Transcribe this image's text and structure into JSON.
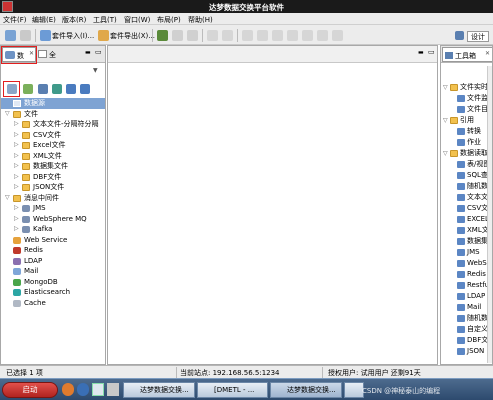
{
  "window": {
    "title": "达梦数据交换平台软件"
  },
  "menu": [
    "文件(F)",
    "编辑(E)",
    "版本(R)",
    "工具(T)",
    "窗口(W)",
    "布局(P)",
    "帮助(H)"
  ],
  "toolbar": {
    "import_label": "套件导入(I)...",
    "export_label": "套件导出(X)...",
    "design_label": "设计"
  },
  "left_panel": {
    "tab_label": "数",
    "tab_label2": "全",
    "root_label": "数据源",
    "tree": [
      {
        "label": "文件",
        "level": 0,
        "expanded": true,
        "icon": "folder"
      },
      {
        "label": "文本文件-分隔符分隔",
        "level": 1,
        "expanded": false,
        "icon": "folder"
      },
      {
        "label": "CSV文件",
        "level": 1,
        "expanded": false,
        "icon": "folder"
      },
      {
        "label": "Excel文件",
        "level": 1,
        "expanded": false,
        "icon": "folder"
      },
      {
        "label": "XML文件",
        "level": 1,
        "expanded": false,
        "icon": "folder"
      },
      {
        "label": "数据集文件",
        "level": 1,
        "expanded": false,
        "icon": "folder"
      },
      {
        "label": "DBF文件",
        "level": 1,
        "expanded": false,
        "icon": "folder"
      },
      {
        "label": "JSON文件",
        "level": 1,
        "expanded": false,
        "icon": "folder"
      },
      {
        "label": "消息中间件",
        "level": 0,
        "expanded": true,
        "icon": "folder"
      },
      {
        "label": "JMS",
        "level": 1,
        "expanded": false,
        "icon": "mq"
      },
      {
        "label": "WebSphere MQ",
        "level": 1,
        "expanded": false,
        "icon": "mq"
      },
      {
        "label": "Kafka",
        "level": 1,
        "expanded": false,
        "icon": "mq"
      },
      {
        "label": "Web Service",
        "level": 0,
        "expanded": null,
        "icon": "web"
      },
      {
        "label": "Redis",
        "level": 0,
        "expanded": null,
        "icon": "redis"
      },
      {
        "label": "LDAP",
        "level": 0,
        "expanded": null,
        "icon": "ldap"
      },
      {
        "label": "Mail",
        "level": 0,
        "expanded": null,
        "icon": "mail"
      },
      {
        "label": "MongoDB",
        "level": 0,
        "expanded": null,
        "icon": "mongo"
      },
      {
        "label": "Elasticsearch",
        "level": 0,
        "expanded": null,
        "icon": "es"
      },
      {
        "label": "Cache",
        "level": 0,
        "expanded": null,
        "icon": "cache"
      }
    ]
  },
  "right_panel": {
    "tab_label": "工具箱",
    "items": [
      {
        "label": "文件实时",
        "level": 0,
        "icon": "folder"
      },
      {
        "label": "文件监",
        "level": 1,
        "icon": "tool"
      },
      {
        "label": "文件目",
        "level": 1,
        "icon": "tool"
      },
      {
        "label": "引用",
        "level": 0,
        "icon": "folder"
      },
      {
        "label": "转换",
        "level": 1,
        "icon": "tool"
      },
      {
        "label": "作业",
        "level": 1,
        "icon": "tool"
      },
      {
        "label": "数据读取",
        "level": 0,
        "icon": "folder"
      },
      {
        "label": "表/视图",
        "level": 1,
        "icon": "tool"
      },
      {
        "label": "SQL查",
        "level": 1,
        "icon": "tool"
      },
      {
        "label": "随机数",
        "level": 1,
        "icon": "tool"
      },
      {
        "label": "文本文",
        "level": 1,
        "icon": "tool"
      },
      {
        "label": "CSV文",
        "level": 1,
        "icon": "tool"
      },
      {
        "label": "EXCEL",
        "level": 1,
        "icon": "tool"
      },
      {
        "label": "XML文",
        "level": 1,
        "icon": "tool"
      },
      {
        "label": "数据集",
        "level": 1,
        "icon": "tool"
      },
      {
        "label": "JMS",
        "level": 1,
        "icon": "tool"
      },
      {
        "label": "WebS",
        "level": 1,
        "icon": "tool"
      },
      {
        "label": "Redis",
        "level": 1,
        "icon": "tool"
      },
      {
        "label": "Restfu",
        "level": 1,
        "icon": "tool"
      },
      {
        "label": "LDAP",
        "level": 1,
        "icon": "tool"
      },
      {
        "label": "Mail",
        "level": 1,
        "icon": "tool"
      },
      {
        "label": "随机数",
        "level": 1,
        "icon": "tool"
      },
      {
        "label": "自定义",
        "level": 1,
        "icon": "tool"
      },
      {
        "label": "DBF文",
        "level": 1,
        "icon": "tool"
      },
      {
        "label": "JSON",
        "level": 1,
        "icon": "tool"
      }
    ]
  },
  "status": {
    "selection": "已选择 1 项",
    "current_site": "当前站点: 192.168.56.5:1234",
    "license": "授权用户: 试用用户 还剩91天"
  },
  "taskbar": {
    "start_label": "启动",
    "tasks": [
      "达梦数据交换...",
      "[DMETL - ...",
      "达梦数据交换..."
    ],
    "watermark": "CSDN @神秘泰山的编程"
  }
}
